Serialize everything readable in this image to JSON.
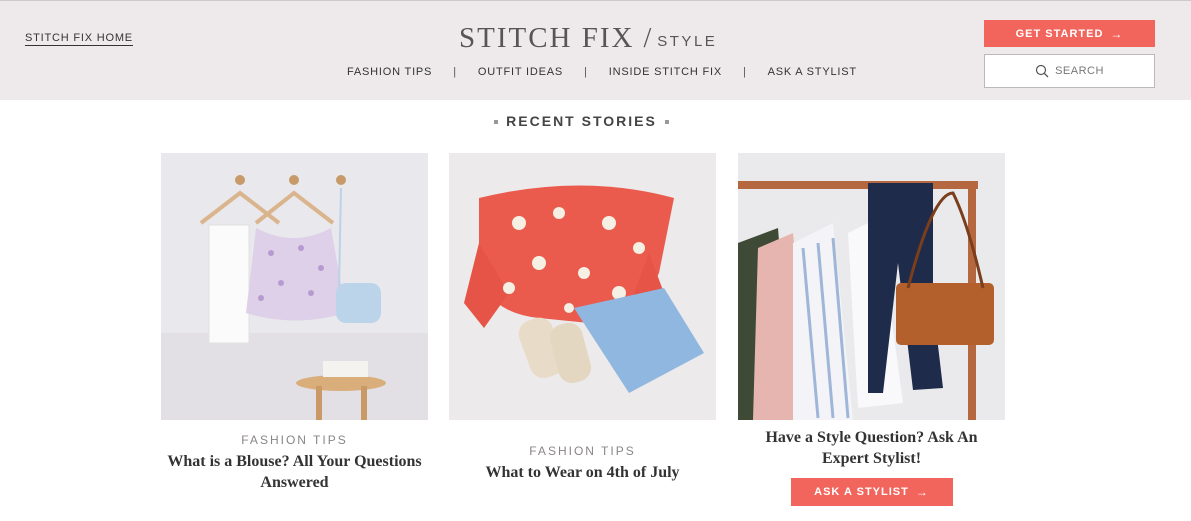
{
  "header": {
    "home_link": "STITCH FIX HOME",
    "logo_main": "STITCH FIX",
    "logo_sub": "STYLE",
    "nav": [
      "FASHION TIPS",
      "OUTFIT IDEAS",
      "INSIDE STITCH FIX",
      "ASK A STYLIST"
    ],
    "get_started": "GET STARTED",
    "search_placeholder": "SEARCH"
  },
  "section_title": "RECENT STORIES",
  "stories": [
    {
      "category": "FASHION TIPS",
      "title": "What is a Blouse? All Your Questions Answered"
    },
    {
      "category": "FASHION TIPS",
      "title": "What to Wear on 4th of July"
    },
    {
      "category": "",
      "title": "Have a Style Question? Ask An Expert Stylist!",
      "button": "ASK A STYLIST"
    }
  ],
  "colors": {
    "accent": "#f2655c",
    "header_bg": "#eeeaeb"
  },
  "icons": {
    "search": "search-icon",
    "arrow": "arrow-right-icon"
  }
}
